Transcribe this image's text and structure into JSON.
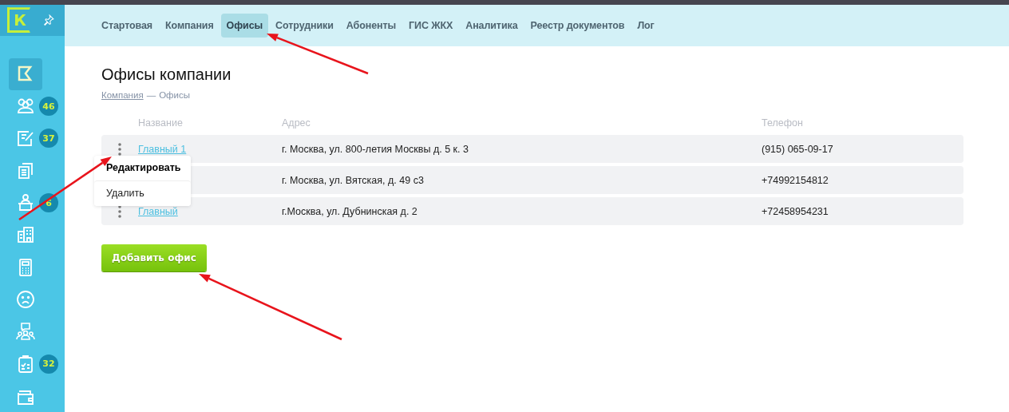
{
  "logo": {
    "letter": "К"
  },
  "sidebar": {
    "items": [
      {
        "selected": true
      },
      {
        "selected": false,
        "badge": "46"
      },
      {
        "selected": false,
        "badge": "37"
      },
      {
        "selected": false
      },
      {
        "selected": false,
        "badge": "6"
      },
      {
        "selected": false
      },
      {
        "selected": false
      },
      {
        "selected": false
      },
      {
        "selected": false
      },
      {
        "selected": false,
        "badge": "32"
      },
      {
        "selected": false
      }
    ]
  },
  "tabs": [
    {
      "label": "Стартовая",
      "selected": false
    },
    {
      "label": "Компания",
      "selected": false
    },
    {
      "label": "Офисы",
      "selected": true
    },
    {
      "label": "Сотрудники",
      "selected": false
    },
    {
      "label": "Абоненты",
      "selected": false
    },
    {
      "label": "ГИС ЖКХ",
      "selected": false
    },
    {
      "label": "Аналитика",
      "selected": false
    },
    {
      "label": "Реестр документов",
      "selected": false
    },
    {
      "label": "Лог",
      "selected": false
    }
  ],
  "page_title": "Офисы компании",
  "breadcrumbs": [
    {
      "label": "Компания",
      "link": true
    },
    {
      "label": "Офисы",
      "link": false
    }
  ],
  "breadcrumb_separator": "—",
  "table": {
    "columns": [
      "Название",
      "Адрес",
      "Телефон"
    ],
    "rows": [
      {
        "name": "Главный 1",
        "address": "г. Москва, ул. 800-летия Москвы д. 5 к. 3",
        "phone": "(915) 065-09-17"
      },
      {
        "address": "г. Москва, ул. Вятская, д. 49 с3",
        "phone": "+74992154812"
      },
      {
        "name": "Главный",
        "address": "г.Москва, ул. Дубнинская д. 2",
        "phone": "+72458954231"
      }
    ]
  },
  "context_menu": {
    "items": [
      {
        "label": "Редактировать",
        "selected": true
      },
      {
        "label": "Удалить",
        "selected": false
      }
    ]
  },
  "add_button": "Добавить офис"
}
